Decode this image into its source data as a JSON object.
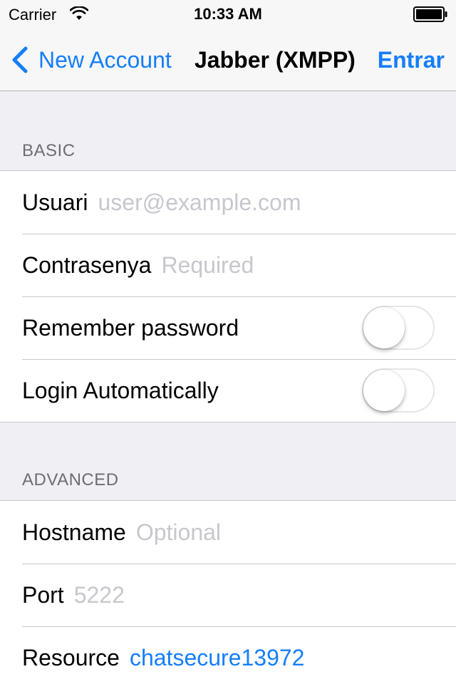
{
  "status_bar": {
    "carrier": "Carrier",
    "time": "10:33 AM",
    "wifi_icon": "wifi-icon",
    "battery_icon": "battery-icon"
  },
  "nav": {
    "back_label": "New Account",
    "back_icon": "chevron-left-icon",
    "title": "Jabber (XMPP)",
    "action_label": "Entrar"
  },
  "colors": {
    "accent": "#157efb",
    "background": "#efeff4",
    "separator": "#c8c7cc",
    "placeholder": "#c7c7cd",
    "section_header": "#6d6d72"
  },
  "basic": {
    "header": "BASIC",
    "username": {
      "label": "Usuari",
      "value": "",
      "placeholder": "user@example.com"
    },
    "password": {
      "label": "Contrasenya",
      "value": "",
      "placeholder": "Required"
    },
    "remember_password": {
      "label": "Remember password",
      "enabled": false
    },
    "login_automatically": {
      "label": "Login Automatically",
      "enabled": false
    }
  },
  "advanced": {
    "header": "ADVANCED",
    "hostname": {
      "label": "Hostname",
      "value": "",
      "placeholder": "Optional"
    },
    "port": {
      "label": "Port",
      "value": "",
      "placeholder": "5222"
    },
    "resource": {
      "label": "Resource",
      "value": "chatsecure13972"
    }
  }
}
